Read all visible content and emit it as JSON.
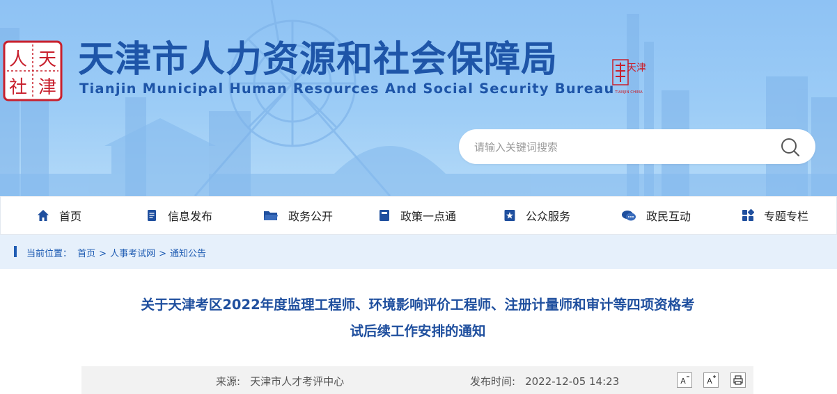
{
  "header": {
    "title_cn": "天津市人力资源和社会保障局",
    "title_en": "Tianjin Municipal Human Resources And Social Security Bureau",
    "seal_chars": [
      "人",
      "天",
      "社",
      "津"
    ],
    "tianjin_logo_text": "天津",
    "tianjin_logo_sub": "TIANJIN CHINA"
  },
  "search": {
    "placeholder": "请输入关键词搜索"
  },
  "nav": {
    "items": [
      {
        "label": "首页",
        "icon": "home-icon"
      },
      {
        "label": "信息发布",
        "icon": "document-icon"
      },
      {
        "label": "政务公开",
        "icon": "folder-icon"
      },
      {
        "label": "政策一点通",
        "icon": "book-icon"
      },
      {
        "label": "公众服务",
        "icon": "star-badge-icon"
      },
      {
        "label": "政民互动",
        "icon": "chat-icon"
      },
      {
        "label": "专题专栏",
        "icon": "grid-icon"
      }
    ]
  },
  "breadcrumb": {
    "prefix": "当前位置：",
    "items": [
      "首页",
      "人事考试网",
      "通知公告"
    ],
    "separator": ">"
  },
  "article": {
    "title_line1": "关于天津考区2022年度监理工程师、环境影响评价工程师、注册计量师和审计等四项资格考",
    "title_line2": "试后续工作安排的通知",
    "source_label": "来源:",
    "source_value": "天津市人才考评中心",
    "time_label": "发布时间:",
    "time_value": "2022-12-05 14:23",
    "tools": [
      "A-",
      "A+",
      "print"
    ]
  },
  "colors": {
    "brand_blue": "#1e55a8",
    "banner_sky": "#8ec2f4",
    "seal_red": "#c8202d",
    "subbar": "#e6f0fb"
  }
}
